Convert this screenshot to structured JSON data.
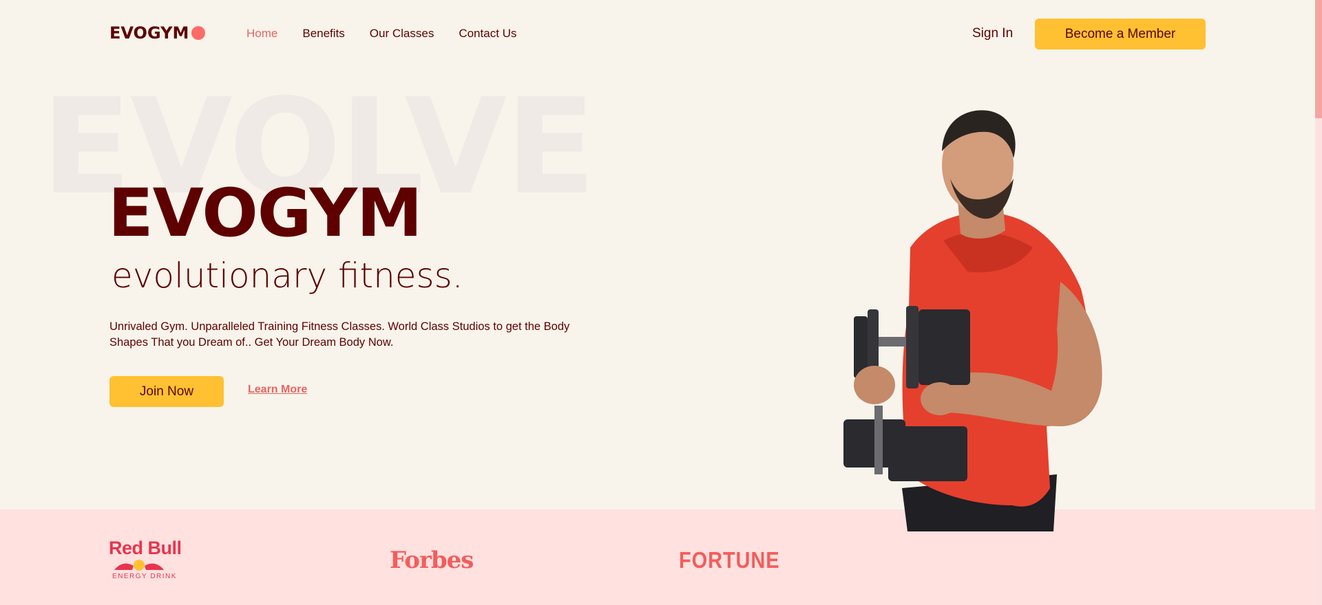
{
  "nav": {
    "logo": "EVOGYM",
    "links": [
      "Home",
      "Benefits",
      "Our Classes",
      "Contact Us"
    ],
    "signin": "Sign In",
    "member_button": "Become a Member"
  },
  "hero": {
    "background_word": "EVOLVE",
    "title": "EVOGYM",
    "subtitle": "evolutionary fitness.",
    "description": "Unrivaled Gym. Unparalleled Training Fitness Classes. World Class Studios to get the Body Shapes That you Dream of.. Get Your Dream Body Now.",
    "join_button": "Join Now",
    "learn_more": "Learn More",
    "image": "man-holding-dumbbells-image"
  },
  "sponsors": {
    "redbull_name": "Red Bull",
    "redbull_tagline": "ENERGY DRINK",
    "forbes": "Forbes",
    "fortune": "FORTUNE"
  },
  "colors": {
    "background": "#f8f4eb",
    "primary_text": "#5e0000",
    "accent_coral": "#e86461",
    "button_yellow": "#ffc132",
    "sponsor_band": "#ffe1e0",
    "sponsor_logos": "#f35d5b",
    "logo_dot": "#ff6b66"
  }
}
